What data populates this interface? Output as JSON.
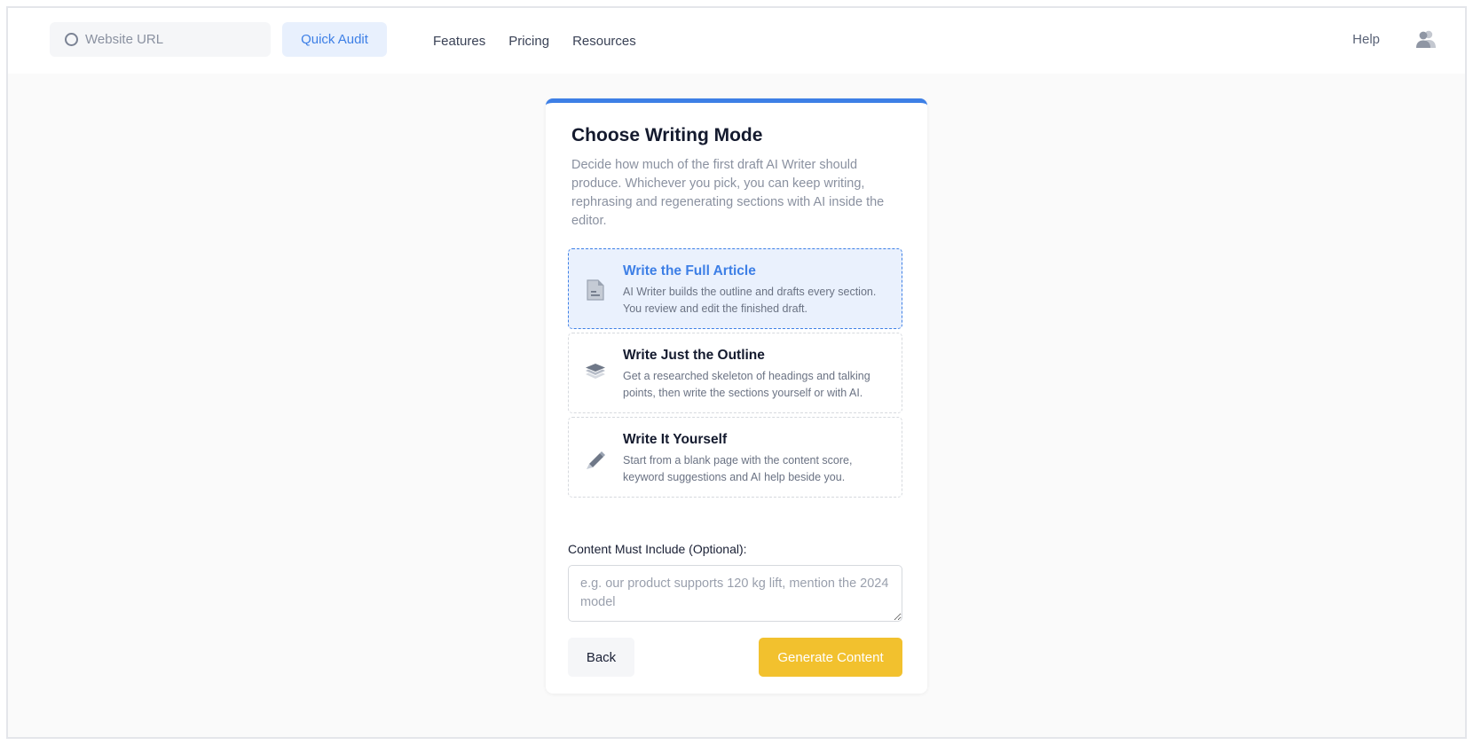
{
  "nav": {
    "search_placeholder": "Website URL",
    "quick_audit_label": "Quick Audit",
    "links": [
      "Features",
      "Pricing",
      "Resources"
    ],
    "help_label": "Help",
    "search_icon": "search-icon",
    "user_icon": "users-icon"
  },
  "card": {
    "title": "Choose Writing Mode",
    "description": "Decide how much of the first draft AI Writer should produce. Whichever you pick, you can keep writing, rephrasing and regenerating sections with AI inside the editor.",
    "accent_color": "#3d7fe6",
    "options": [
      {
        "title": "Write the Full Article",
        "description": "AI Writer builds the outline and drafts every section. You review and edit the finished draft.",
        "icon": "document-icon",
        "selected": true
      },
      {
        "title": "Write Just the Outline",
        "description": "Get a researched skeleton of headings and talking points, then write the sections yourself or with AI.",
        "icon": "layers-icon",
        "selected": false
      },
      {
        "title": "Write It Yourself",
        "description": "Start from a blank page with the content score, keyword suggestions and AI help beside you.",
        "icon": "pencil-icon",
        "selected": false
      }
    ],
    "must_include": {
      "label": "Content Must Include (Optional):",
      "placeholder": "e.g. our product supports 120 kg lift, mention the 2024 model",
      "value": ""
    },
    "back_label": "Back",
    "generate_label": "Generate Content",
    "generate_color": "#f2c12e"
  }
}
